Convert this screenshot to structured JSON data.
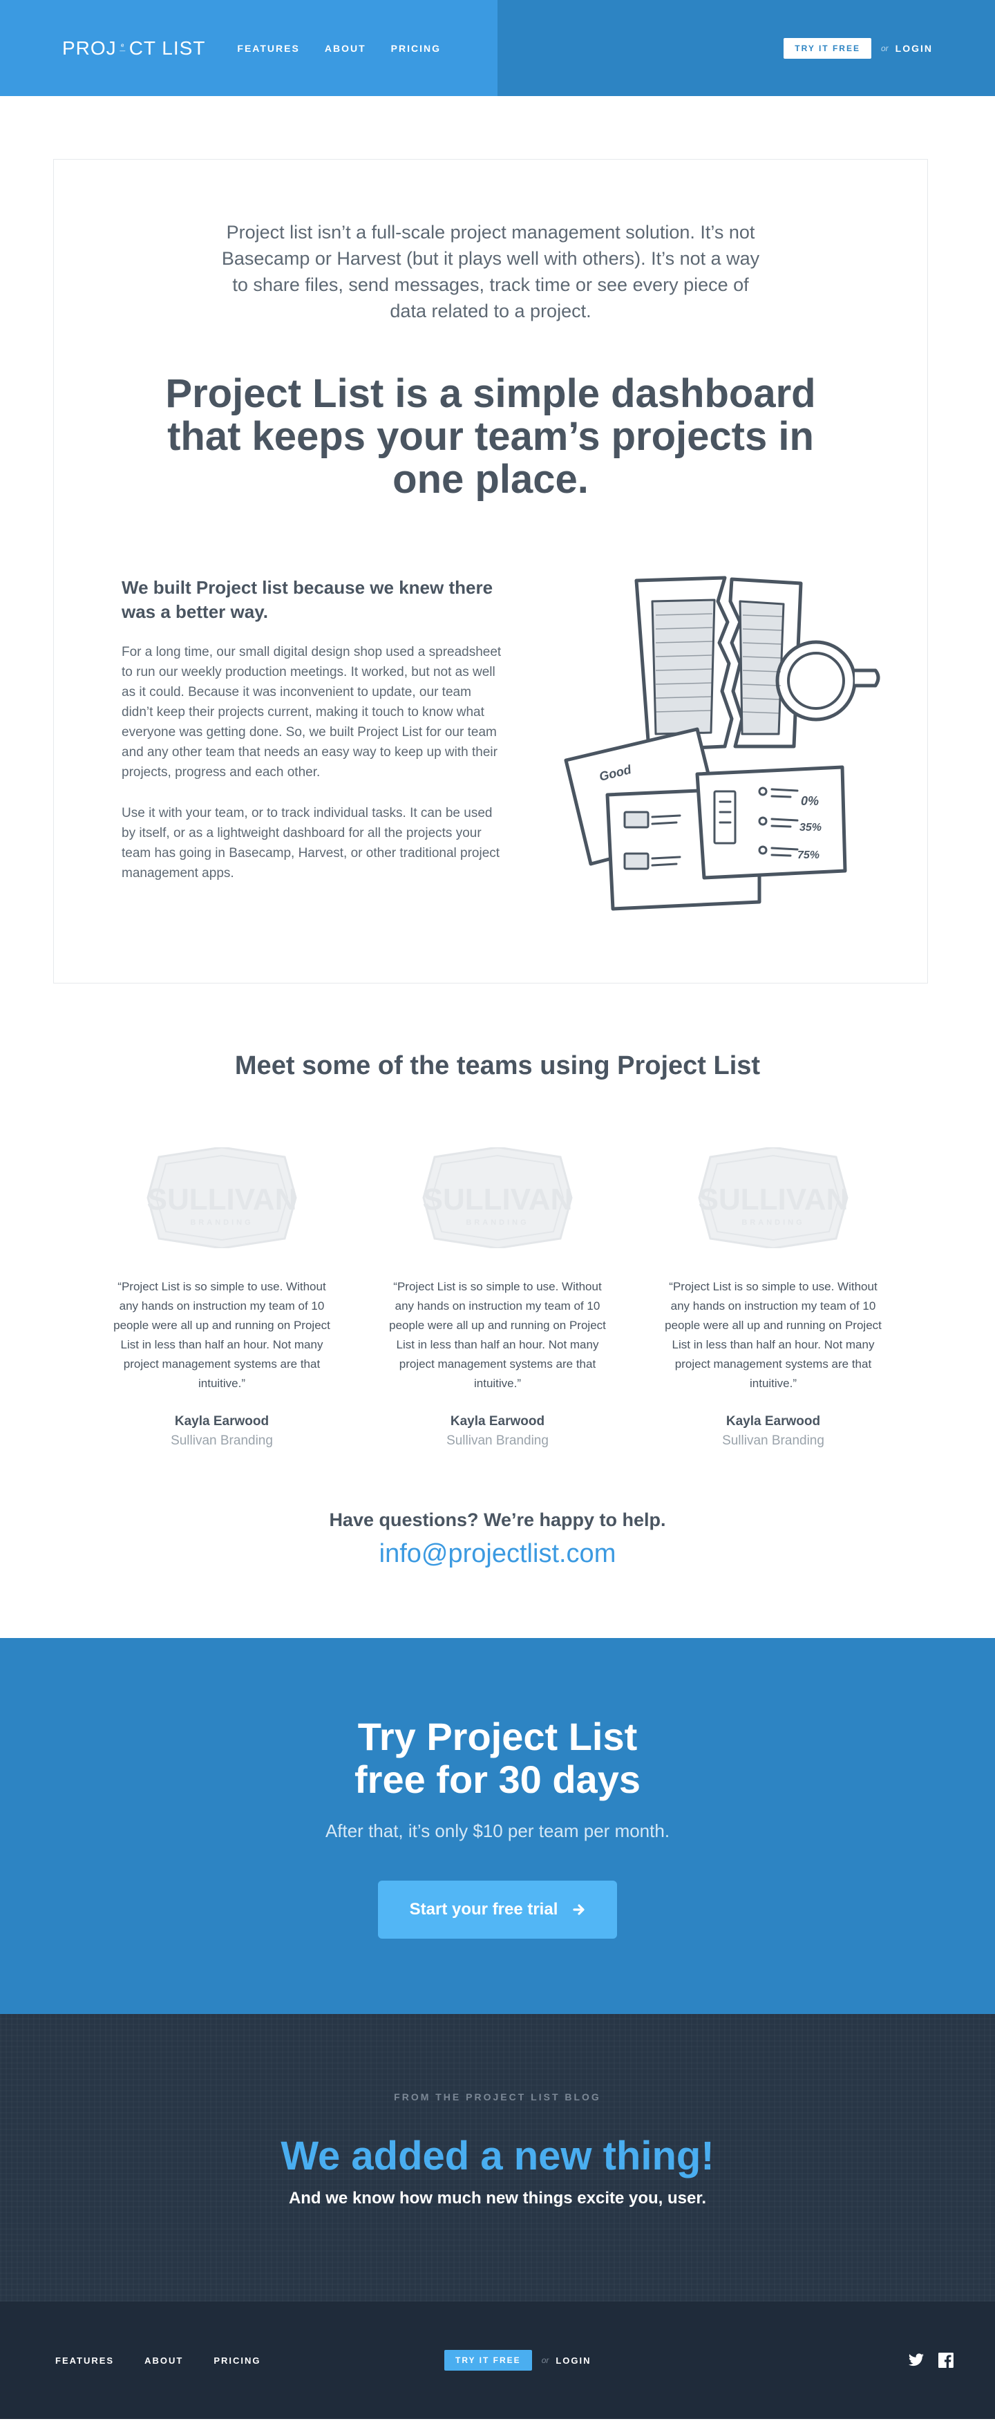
{
  "header": {
    "logo": {
      "part1": "PROJ",
      "part2_small": "e—",
      "part3": "CT LIST"
    },
    "nav": [
      "FEATURES",
      "ABOUT",
      "PRICING"
    ],
    "try_label": "TRY IT FREE",
    "or_label": "or",
    "login_label": "LOGIN"
  },
  "intro": {
    "paragraph": "Project list isn’t a full-scale project management solution. It’s not Basecamp or Harvest (but it plays well with others). It’s not a way to share files, send messages, track time or see every piece of data related to a project.",
    "headline": "Project List is a simple dashboard that keeps your team’s projects in one place."
  },
  "about": {
    "title": "We built Project list because we knew there was a better way.",
    "p1": "For a long time, our small digital design shop used a spreadsheet to run our weekly production meetings. It worked, but not as well as it could. Because it was inconvenient to update, our team didn’t keep their projects current, making it touch to know what everyone was getting done. So, we built Project List for our team and any other team that needs an easy way to keep up with their projects, progress and each other.",
    "p2": "Use it with your team, or to track individual tasks. It can be used by itself, or as a lightweight dashboard for all the projects your team has going in Basecamp, Harvest, or other traditional project management apps.",
    "illustration": {
      "note_text": "Good",
      "percents": [
        "0%",
        "35%",
        "75%"
      ]
    }
  },
  "teams": {
    "title": "Meet some of the teams using Project List",
    "badge": {
      "line1": "SULLIVAN",
      "line2": "BRANDING"
    },
    "testimonials": [
      {
        "quote": "“Project List is so simple to use. Without any hands on instruction my team of 10 people were all up and running on Project List in less than half an hour. Not many project management systems are that intuitive.”",
        "name": "Kayla Earwood",
        "company": "Sullivan Branding"
      },
      {
        "quote": "“Project List is so simple to use. Without any hands on instruction my team of 10 people were all up and running on Project List in less than half an hour. Not many project management systems are that intuitive.”",
        "name": "Kayla Earwood",
        "company": "Sullivan Branding"
      },
      {
        "quote": "“Project List is so simple to use. Without any hands on instruction my team of 10 people were all up and running on Project List in less than half an hour. Not many project management systems are that intuitive.”",
        "name": "Kayla Earwood",
        "company": "Sullivan Branding"
      }
    ]
  },
  "questions": {
    "title": "Have questions? We’re happy to help.",
    "email": "info@projectlist.com"
  },
  "trial": {
    "line1": "Try Project List",
    "line2": "free for 30 days",
    "subtitle": "After that, it’s only $10 per team per month.",
    "button": "Start your free trial"
  },
  "blog": {
    "kicker": "FROM THE PROJECT LIST BLOG",
    "title": "We added a new thing!",
    "subtitle": "And we know how much new things excite you, user."
  },
  "footer": {
    "nav": [
      "FEATURES",
      "ABOUT",
      "PRICING"
    ],
    "try_label": "TRY IT FREE",
    "or_label": "or",
    "login_label": "LOGIN",
    "social": [
      "twitter-icon",
      "facebook-icon"
    ]
  },
  "colors": {
    "header_left": "#3b9ae1",
    "header_right": "#2d84c3",
    "trial_bg": "#2d84c3",
    "cta_button": "#52b6f5",
    "blog_bg": "#283646",
    "footer_bg": "#1f2b3a",
    "blog_title": "#4aaef0"
  }
}
